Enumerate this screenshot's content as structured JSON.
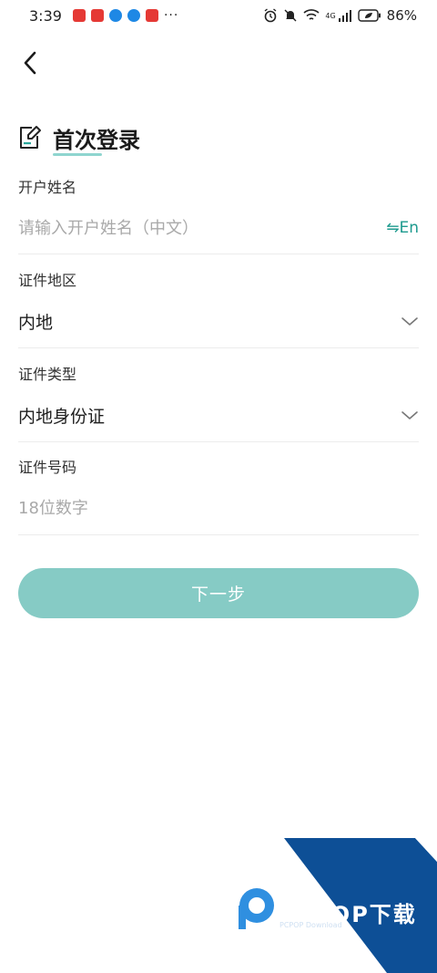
{
  "status_bar": {
    "time": "3:39",
    "more": "···",
    "battery": "86%",
    "network": "4G"
  },
  "header": {
    "back_icon": "chevron-left-icon",
    "title": "首次登录"
  },
  "form": {
    "name": {
      "label": "开户姓名",
      "placeholder": "请输入开户姓名（中文）",
      "lang_toggle": "⇋En"
    },
    "region": {
      "label": "证件地区",
      "value": "内地"
    },
    "id_type": {
      "label": "证件类型",
      "value": "内地身份证"
    },
    "id_number": {
      "label": "证件号码",
      "placeholder": "18位数字"
    }
  },
  "actions": {
    "next_label": "下一步"
  },
  "watermark": {
    "brand": "PCPOP下载",
    "sub": "PCPOP Download"
  },
  "colors": {
    "accent": "#1d9a8e",
    "button": "#86cbc5",
    "watermark_blue": "#0d4f96"
  }
}
